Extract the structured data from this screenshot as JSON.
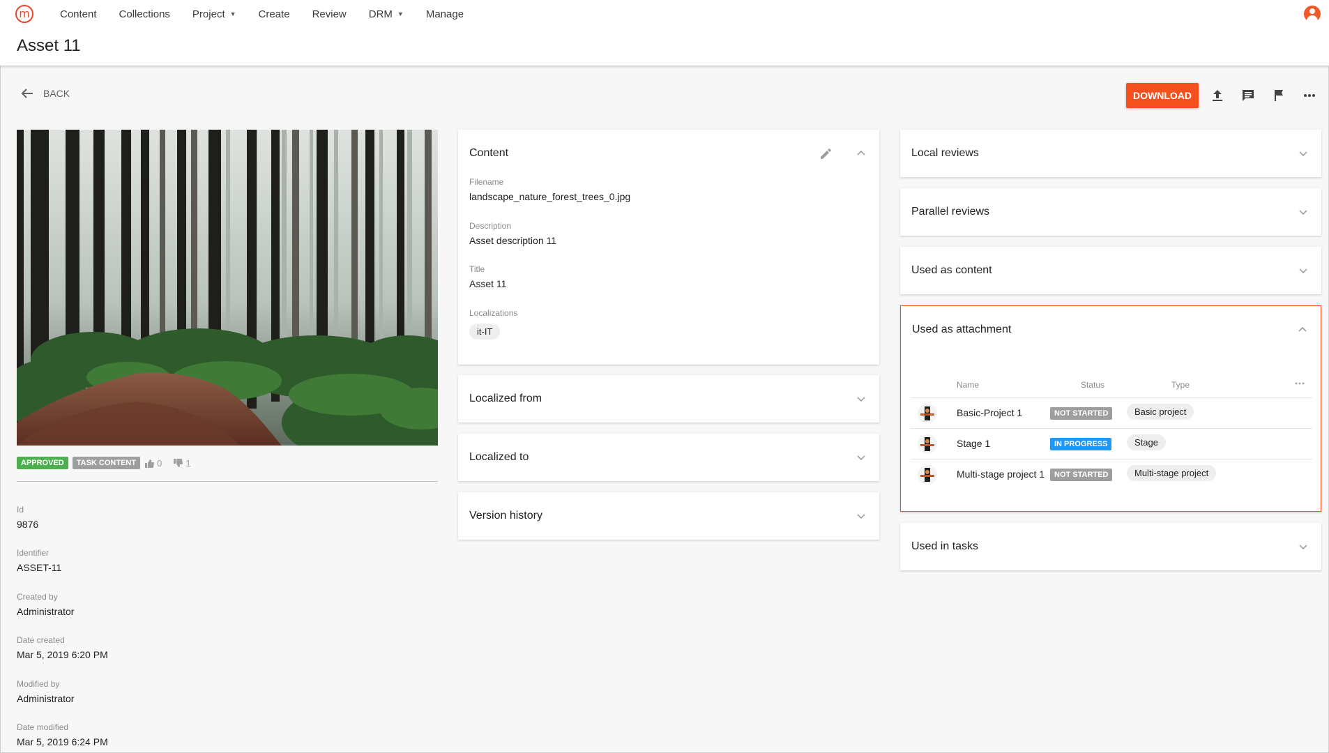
{
  "nav": {
    "logo_text": "m",
    "items": [
      {
        "label": "Content",
        "dropdown": false
      },
      {
        "label": "Collections",
        "dropdown": false
      },
      {
        "label": "Project",
        "dropdown": true
      },
      {
        "label": "Create",
        "dropdown": false
      },
      {
        "label": "Review",
        "dropdown": false
      },
      {
        "label": "DRM",
        "dropdown": true
      },
      {
        "label": "Manage",
        "dropdown": false
      }
    ]
  },
  "page": {
    "title": "Asset 11"
  },
  "toolbar": {
    "back_label": "BACK",
    "download_label": "DOWNLOAD",
    "icons": [
      "upload-icon",
      "comment-icon",
      "flag-icon",
      "more-icon"
    ]
  },
  "asset": {
    "badges": [
      "APPROVED",
      "TASK CONTENT"
    ],
    "likes": "0",
    "dislikes": "1",
    "meta": [
      {
        "label": "Id",
        "value": "9876"
      },
      {
        "label": "Identifier",
        "value": "ASSET-11"
      },
      {
        "label": "Created by",
        "value": "Administrator"
      },
      {
        "label": "Date created",
        "value": "Mar 5, 2019 6:20 PM"
      },
      {
        "label": "Modified by",
        "value": "Administrator"
      },
      {
        "label": "Date modified",
        "value": "Mar 5, 2019 6:24 PM"
      }
    ]
  },
  "content_card": {
    "title": "Content",
    "fields": [
      {
        "label": "Filename",
        "value": "landscape_nature_forest_trees_0.jpg"
      },
      {
        "label": "Description",
        "value": "Asset description 11"
      },
      {
        "label": "Title",
        "value": "Asset 11"
      }
    ],
    "localizations_label": "Localizations",
    "localizations": [
      "it-IT"
    ]
  },
  "middle_sections": [
    "Localized from",
    "Localized to",
    "Version history"
  ],
  "right_sections": {
    "local_reviews": "Local reviews",
    "parallel_reviews": "Parallel reviews",
    "used_as_content": "Used as content",
    "used_in_tasks": "Used in tasks"
  },
  "attachment": {
    "title": "Used as attachment",
    "columns": [
      "Name",
      "Status",
      "Type"
    ],
    "rows": [
      {
        "name": "Basic-Project 1",
        "status": "NOT STARTED",
        "type": "Basic project"
      },
      {
        "name": "Stage 1",
        "status": "IN PROGRESS",
        "type": "Stage"
      },
      {
        "name": "Multi-stage project 1",
        "status": "NOT STARTED",
        "type": "Multi-stage project"
      }
    ]
  },
  "colors": {
    "accent": "#f4511e",
    "approved": "#4caf50",
    "grey_badge": "#9e9e9e",
    "in_progress": "#2196f3"
  }
}
